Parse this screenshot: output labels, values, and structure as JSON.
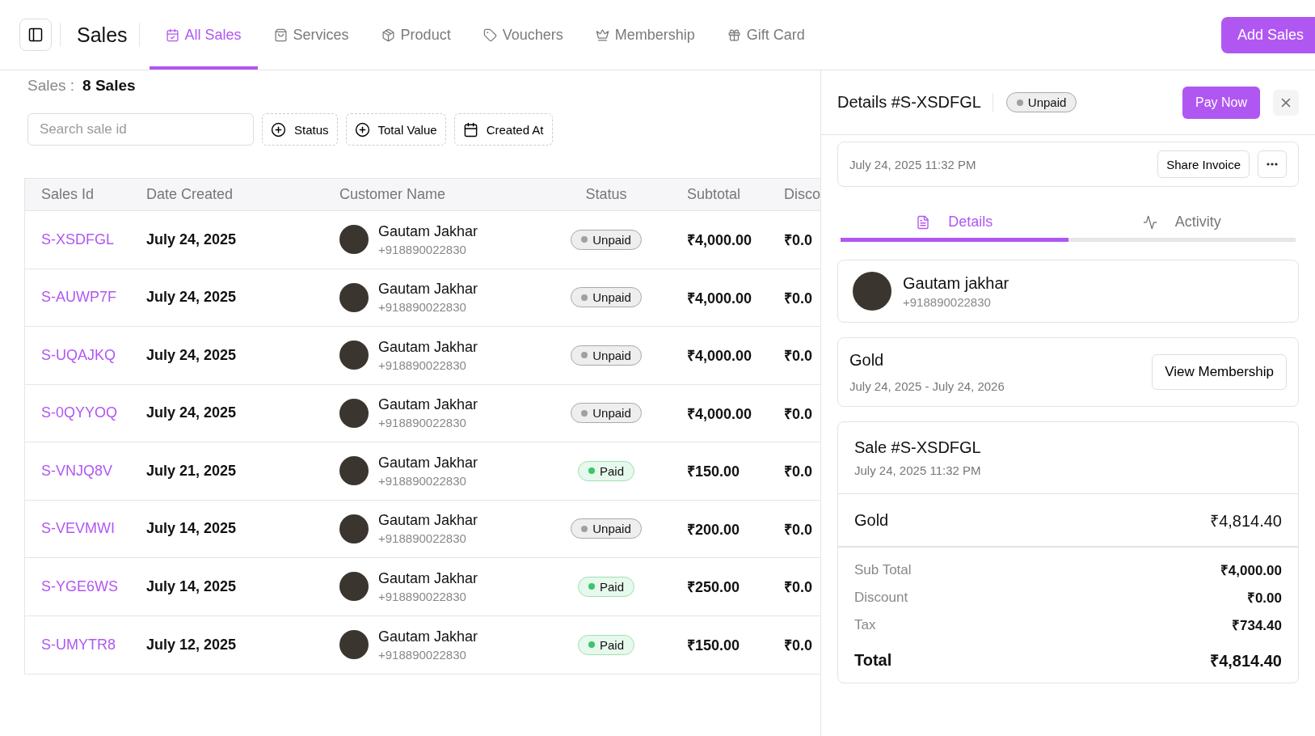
{
  "header": {
    "title": "Sales",
    "nav_tabs": [
      {
        "label": "All Sales",
        "selected": true
      },
      {
        "label": "Services",
        "selected": false
      },
      {
        "label": "Product",
        "selected": false
      },
      {
        "label": "Vouchers",
        "selected": false
      },
      {
        "label": "Membership",
        "selected": false
      },
      {
        "label": "Gift Card",
        "selected": false
      }
    ],
    "primary_button": "Add Sales"
  },
  "summary": {
    "label": "Sales :",
    "value": "8 Sales"
  },
  "search": {
    "placeholder": "Search sale id"
  },
  "filters": [
    "Status",
    "Total Value",
    "Created At"
  ],
  "table": {
    "columns": [
      "Sales Id",
      "Date Created",
      "Customer Name",
      "Status",
      "Subtotal",
      "Disco"
    ],
    "rows": [
      {
        "id": "S-XSDFGL",
        "date": "July 24, 2025",
        "customer": "Gautam Jakhar",
        "phone": "+918890022830",
        "status": {
          "label": "Unpaid",
          "kind": "unpaid"
        },
        "subtotal": "₹4,000.00",
        "column_6": "₹0.0"
      },
      {
        "id": "S-AUWP7F",
        "date": "July 24, 2025",
        "customer": "Gautam Jakhar",
        "phone": "+918890022830",
        "status": {
          "label": "Unpaid",
          "kind": "unpaid"
        },
        "subtotal": "₹4,000.00",
        "column_6": "₹0.0"
      },
      {
        "id": "S-UQAJKQ",
        "date": "July 24, 2025",
        "customer": "Gautam Jakhar",
        "phone": "+918890022830",
        "status": {
          "label": "Unpaid",
          "kind": "unpaid"
        },
        "subtotal": "₹4,000.00",
        "column_6": "₹0.0"
      },
      {
        "id": "S-0QYYOQ",
        "date": "July 24, 2025",
        "customer": "Gautam Jakhar",
        "phone": "+918890022830",
        "status": {
          "label": "Unpaid",
          "kind": "unpaid"
        },
        "subtotal": "₹4,000.00",
        "column_6": "₹0.0"
      },
      {
        "id": "S-VNJQ8V",
        "date": "July 21, 2025",
        "customer": "Gautam Jakhar",
        "phone": "+918890022830",
        "status": {
          "label": "Paid",
          "kind": "paid"
        },
        "subtotal": "₹150.00",
        "column_6": "₹0.0"
      },
      {
        "id": "S-VEVMWI",
        "date": "July 14, 2025",
        "customer": "Gautam Jakhar",
        "phone": "+918890022830",
        "status": {
          "label": "Unpaid",
          "kind": "unpaid"
        },
        "subtotal": "₹200.00",
        "column_6": "₹0.0"
      },
      {
        "id": "S-YGE6WS",
        "date": "July 14, 2025",
        "customer": "Gautam Jakhar",
        "phone": "+918890022830",
        "status": {
          "label": "Paid",
          "kind": "paid"
        },
        "subtotal": "₹250.00",
        "column_6": "₹0.0"
      },
      {
        "id": "S-UMYTR8",
        "date": "July 12, 2025",
        "customer": "Gautam Jakhar",
        "phone": "+918890022830",
        "status": {
          "label": "Paid",
          "kind": "paid"
        },
        "subtotal": "₹150.00",
        "column_6": "₹0.0"
      }
    ]
  },
  "details": {
    "title": "Details #S-XSDFGL",
    "status": {
      "label": "Unpaid",
      "kind": "unpaid"
    },
    "pay_button": "Pay Now",
    "invoice_card": {
      "date": "July 24, 2025 11:32 PM",
      "share_button": "Share Invoice"
    },
    "tabs": [
      {
        "label": "Details",
        "selected": true
      },
      {
        "label": "Activity",
        "selected": false
      }
    ],
    "customer": {
      "name": "Gautam jakhar",
      "phone": "+918890022830"
    },
    "membership": {
      "name": "Gold",
      "period": "July 24, 2025 - July 24, 2026",
      "button": "View Membership"
    },
    "sale": {
      "title": "Sale #S-XSDFGL",
      "date": "July 24, 2025 11:32 PM",
      "item": {
        "name": "Gold",
        "amount": "₹4,814.40"
      },
      "breakdown": [
        {
          "label": "Sub Total",
          "value": "₹4,000.00"
        },
        {
          "label": "Discount",
          "value": "₹0.00"
        },
        {
          "label": "Tax",
          "value": "₹734.40"
        }
      ],
      "total": {
        "label": "Total",
        "value": "₹4,814.40"
      }
    }
  }
}
